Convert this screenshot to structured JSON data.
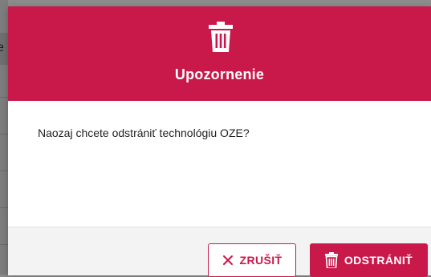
{
  "background": {
    "partial_text": "e ["
  },
  "dialog": {
    "title": "Upozornenie",
    "header_icon": "trash-icon",
    "message": "Naozaj chcete odstrániť technológiu OZE?",
    "buttons": {
      "cancel_label": "ZRUŠIŤ",
      "cancel_icon": "close-icon",
      "delete_label": "ODSTRÁNIŤ",
      "delete_icon": "trash-icon"
    }
  },
  "colors": {
    "accent": "#c9184a",
    "backdrop": "#8c8c8c",
    "footer": "#f3f3f3"
  }
}
